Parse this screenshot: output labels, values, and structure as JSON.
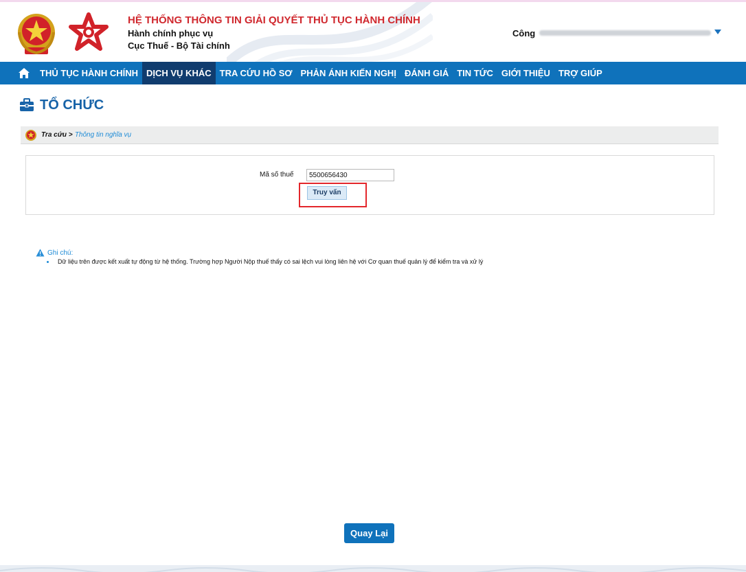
{
  "header": {
    "title": "HỆ THỐNG THÔNG TIN GIẢI QUYẾT THỦ TỤC HÀNH CHÍNH",
    "subtitle_1": "Hành chính phục vụ",
    "subtitle_2": "Cục Thuế - Bộ Tài chính",
    "user_name": "Công"
  },
  "nav": {
    "items": [
      {
        "label": "THỦ TỤC HÀNH CHÍNH",
        "active": false
      },
      {
        "label": "DỊCH VỤ KHÁC",
        "active": true
      },
      {
        "label": "TRA CỨU HỒ SƠ",
        "active": false
      },
      {
        "label": "PHẢN ÁNH KIẾN NGHỊ",
        "active": false
      },
      {
        "label": "ĐÁNH GIÁ",
        "active": false
      },
      {
        "label": "TIN TỨC",
        "active": false
      },
      {
        "label": "GIỚI THIỆU",
        "active": false
      },
      {
        "label": "TRỢ GIÚP",
        "active": false
      }
    ]
  },
  "page": {
    "title": "TỔ CHỨC"
  },
  "breadcrumb": {
    "home": "Tra cứu",
    "separator": ">",
    "current": "Thông tin nghĩa vụ"
  },
  "form": {
    "tax_code_label": "Mã số thuế",
    "tax_code_value": "5500656430",
    "query_button": "Truy vấn"
  },
  "note": {
    "title": "Ghi chú:",
    "items": [
      "Dữ liệu trên được kết xuất tự động từ hệ thống. Trường hợp Người Nộp thuế thấy có sai lệch vui lòng liên hệ với Cơ quan thuế quản lý để kiểm tra và xử lý"
    ]
  },
  "back_button": "Quay Lại",
  "colors": {
    "nav_bg": "#0f72bb",
    "nav_active": "#103c6e",
    "title_red": "#d0282e",
    "page_title_blue": "#1763a8",
    "link_blue": "#1e8bd6",
    "highlight": "#e3262b"
  },
  "icons": [
    "national-emblem-icon",
    "star-logo-icon",
    "home-icon",
    "briefcase-icon",
    "warning-icon",
    "chevron-down-icon"
  ]
}
